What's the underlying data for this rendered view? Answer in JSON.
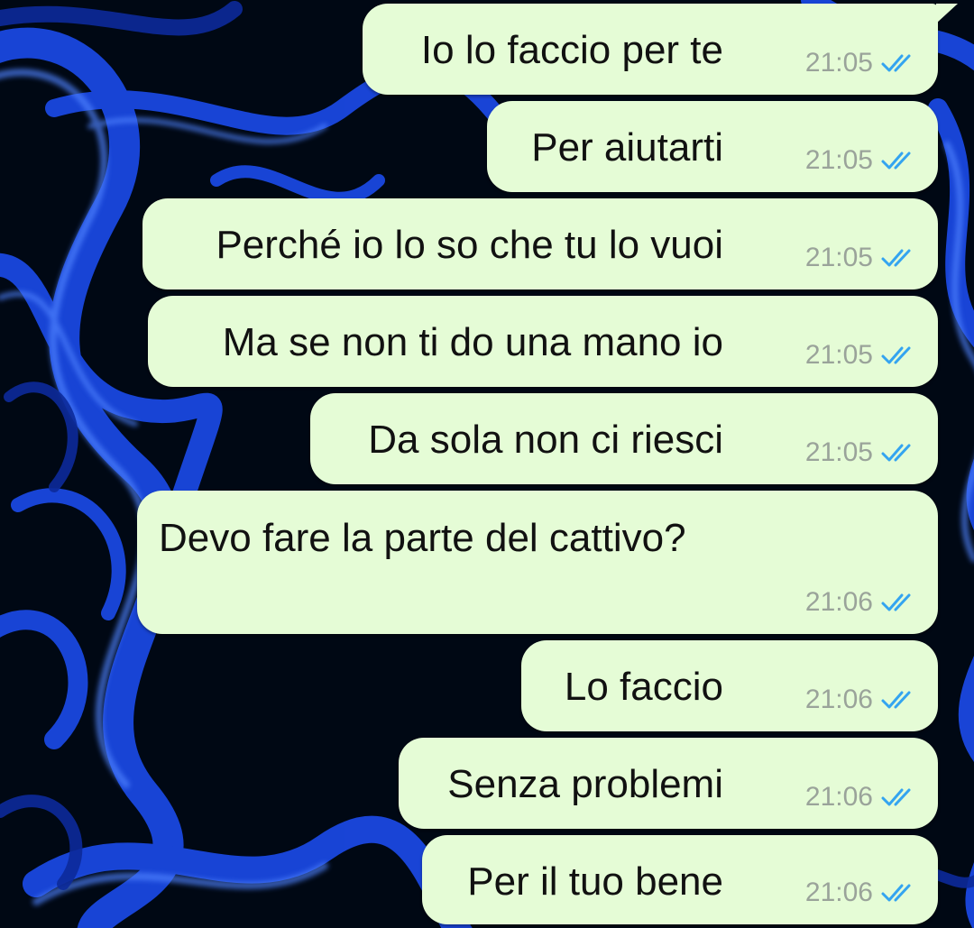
{
  "colors": {
    "bubble": "#e5fcd6",
    "text": "#111111",
    "time": "#9aa39a",
    "read_ticks": "#34a4f0",
    "wallpaper_dark": "#000814",
    "wallpaper_blue": "#1a48e0"
  },
  "messages": [
    {
      "text": "Io lo faccio per te",
      "time": "21:05",
      "status_icon": "double-check-read-icon"
    },
    {
      "text": "Per aiutarti",
      "time": "21:05",
      "status_icon": "double-check-read-icon"
    },
    {
      "text": "Perché io lo so che tu lo vuoi",
      "time": "21:05",
      "status_icon": "double-check-read-icon"
    },
    {
      "text": "Ma se non ti do una mano io",
      "time": "21:05",
      "status_icon": "double-check-read-icon"
    },
    {
      "text": "Da sola non ci riesci",
      "time": "21:05",
      "status_icon": "double-check-read-icon"
    },
    {
      "text": "Devo fare la parte del cattivo?",
      "time": "21:06",
      "status_icon": "double-check-read-icon"
    },
    {
      "text": "Lo faccio",
      "time": "21:06",
      "status_icon": "double-check-read-icon"
    },
    {
      "text": "Senza problemi",
      "time": "21:06",
      "status_icon": "double-check-read-icon"
    },
    {
      "text": "Per il tuo bene",
      "time": "21:06",
      "status_icon": "double-check-read-icon"
    }
  ]
}
